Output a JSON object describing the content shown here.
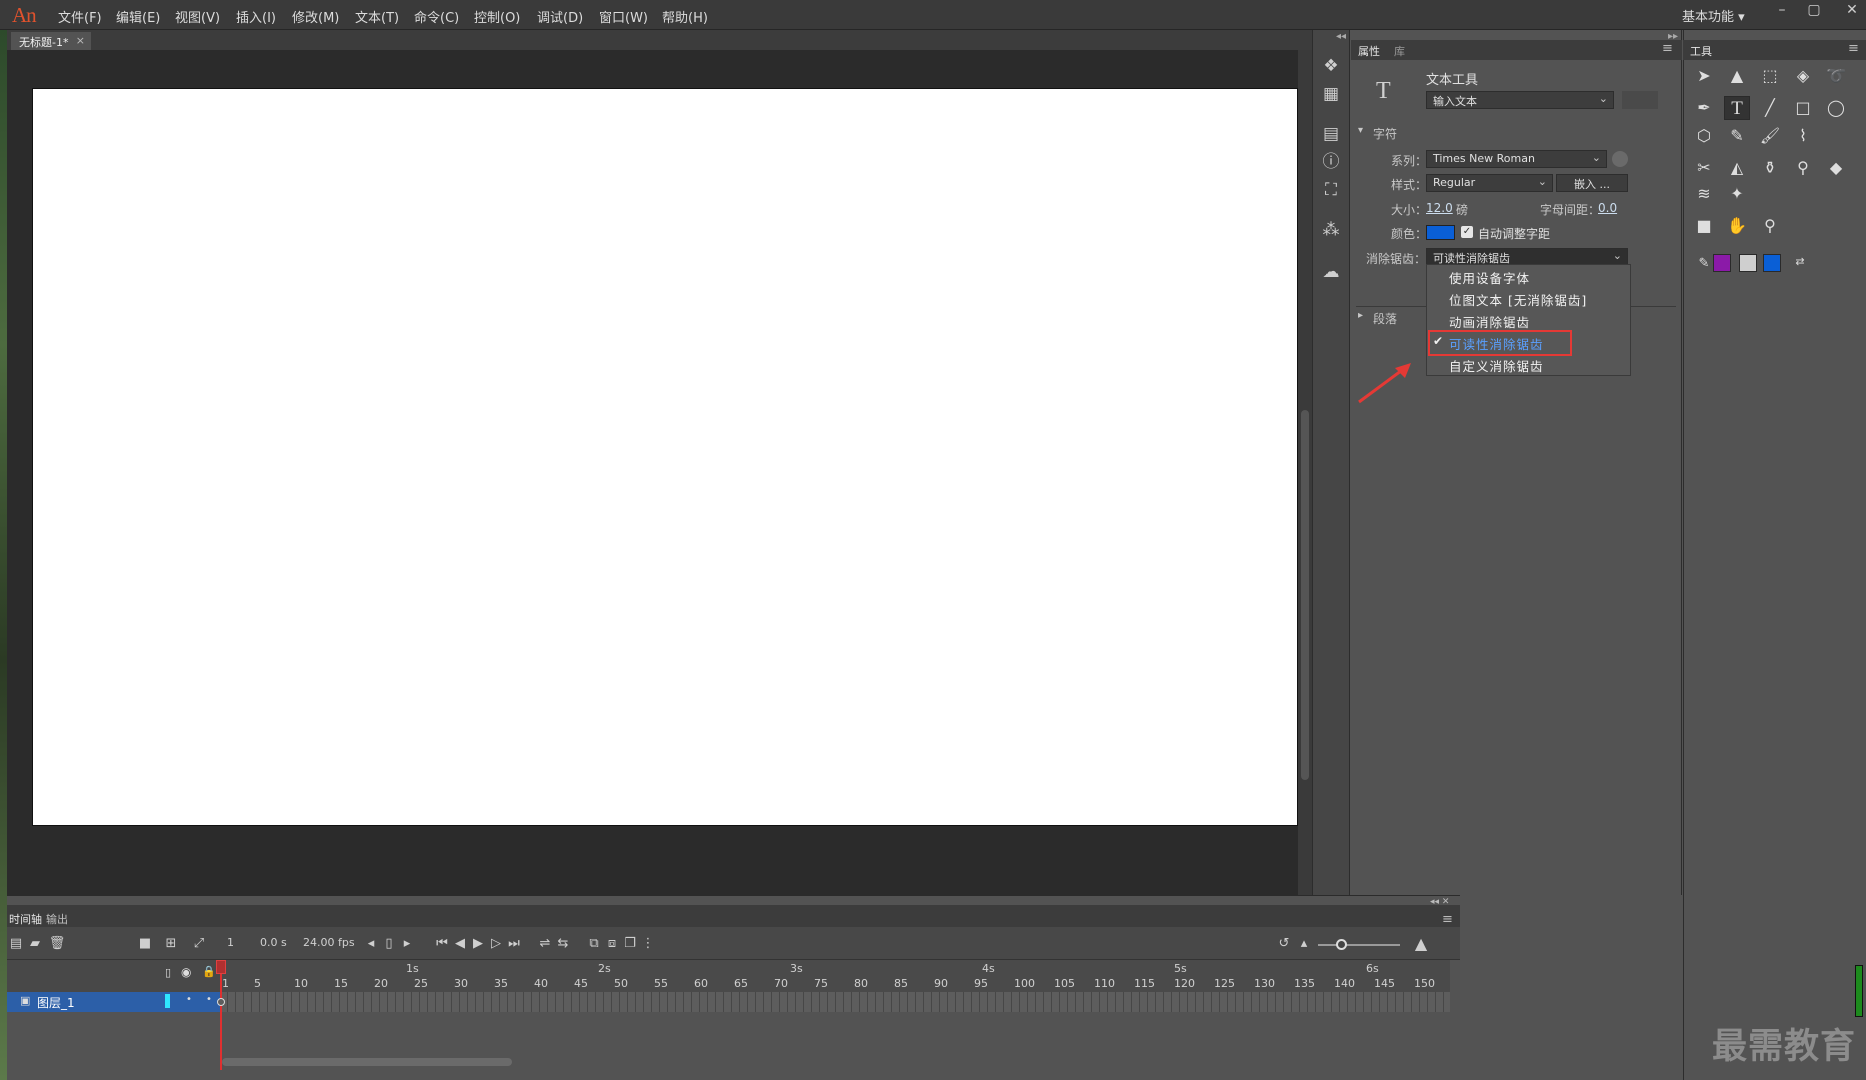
{
  "app": {
    "logo": "An",
    "menus": [
      "文件(F)",
      "编辑(E)",
      "视图(V)",
      "插入(I)",
      "修改(M)",
      "文本(T)",
      "命令(C)",
      "控制(O)",
      "调试(D)",
      "窗口(W)",
      "帮助(H)"
    ],
    "workspace": "基本功能",
    "window_buttons": [
      "–",
      "▢",
      "✕"
    ]
  },
  "document": {
    "tab": "无标题-1*",
    "close": "×"
  },
  "properties": {
    "tabs": [
      "属性",
      "库"
    ],
    "tool_name": "文本工具",
    "text_type": "输入文本",
    "character_section": "字符",
    "family_label": "系列：",
    "family_value": "Times New Roman",
    "style_label": "样式：",
    "style_value": "Regular",
    "embed_button": "嵌入 ...",
    "size_label": "大小：",
    "size_value": "12.0",
    "size_unit": "磅",
    "spacing_label": "字母间距：",
    "spacing_value": "0.0",
    "color_label": "颜色：",
    "color_value": "#0a5fd6",
    "auto_kern": "自动调整字距",
    "antialias_label": "消除锯齿：",
    "antialias_value": "可读性消除锯齿",
    "antialias_options": [
      "使用设备字体",
      "位图文本 [无消除锯齿]",
      "动画消除锯齿",
      "可读性消除锯齿",
      "自定义消除锯齿"
    ],
    "selected_index": 3,
    "paragraph_section": "段落"
  },
  "tools_panel": {
    "title": "工具",
    "stroke_color": "#8b1aa8",
    "fill_color": "#0a5fd6"
  },
  "timeline": {
    "tabs": [
      "时间轴",
      "输出"
    ],
    "frame": "1",
    "time": "0.0 s",
    "fps": "24.00 fps",
    "layer_name": "图层_1",
    "seconds": [
      "1s",
      "2s",
      "3s",
      "4s",
      "5s",
      "6s"
    ],
    "frame_numbers": [
      "1",
      "5",
      "10",
      "15",
      "20",
      "25",
      "30",
      "35",
      "40",
      "45",
      "50",
      "55",
      "60",
      "65",
      "70",
      "75",
      "80",
      "85",
      "90",
      "95",
      "100",
      "105",
      "110",
      "115",
      "120",
      "125",
      "130",
      "135",
      "140",
      "145",
      "150"
    ]
  },
  "watermark": "最需教育"
}
